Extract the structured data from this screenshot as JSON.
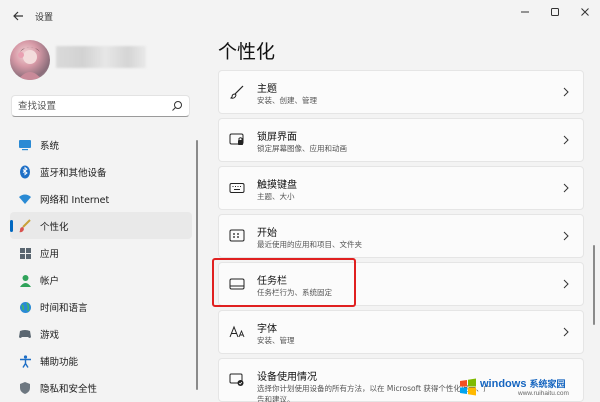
{
  "window": {
    "title": "设置"
  },
  "search": {
    "placeholder": "查找设置"
  },
  "sidebar": {
    "items": [
      {
        "label": "系统",
        "icon": "system-icon",
        "selected": false
      },
      {
        "label": "蓝牙和其他设备",
        "icon": "bluetooth-icon",
        "selected": false
      },
      {
        "label": "网络和 Internet",
        "icon": "wifi-icon",
        "selected": false
      },
      {
        "label": "个性化",
        "icon": "brush-icon",
        "selected": true
      },
      {
        "label": "应用",
        "icon": "apps-icon",
        "selected": false
      },
      {
        "label": "帐户",
        "icon": "account-icon",
        "selected": false
      },
      {
        "label": "时间和语言",
        "icon": "globe-icon",
        "selected": false
      },
      {
        "label": "游戏",
        "icon": "gamepad-icon",
        "selected": false
      },
      {
        "label": "辅助功能",
        "icon": "accessibility-icon",
        "selected": false
      },
      {
        "label": "隐私和安全性",
        "icon": "shield-icon",
        "selected": false
      }
    ]
  },
  "main": {
    "title": "个性化",
    "cards": [
      {
        "title": "主题",
        "subtitle": "安装、创建、管理",
        "icon": "brush-icon"
      },
      {
        "title": "锁屏界面",
        "subtitle": "锁定屏幕图像、应用和动画",
        "icon": "lock-screen-icon"
      },
      {
        "title": "触摸键盘",
        "subtitle": "主题、大小",
        "icon": "keyboard-icon"
      },
      {
        "title": "开始",
        "subtitle": "最近使用的应用和项目、文件夹",
        "icon": "start-icon"
      },
      {
        "title": "任务栏",
        "subtitle": "任务栏行为、系统固定",
        "icon": "taskbar-icon",
        "highlighted": true
      },
      {
        "title": "字体",
        "subtitle": "安装、管理",
        "icon": "font-icon"
      },
      {
        "title": "设备使用情况",
        "subtitle": "选择你计划使用设备的所有方法，以在 Microsoft 获得个性化提示、广告和建议。",
        "icon": "device-usage-icon"
      }
    ]
  },
  "watermark": {
    "brand": "windows",
    "cn": "系统家园",
    "url": "www.ruihaitu.com"
  },
  "colors": {
    "accent": "#0067c0",
    "highlight": "#e02020",
    "background": "#f3f3f3"
  }
}
